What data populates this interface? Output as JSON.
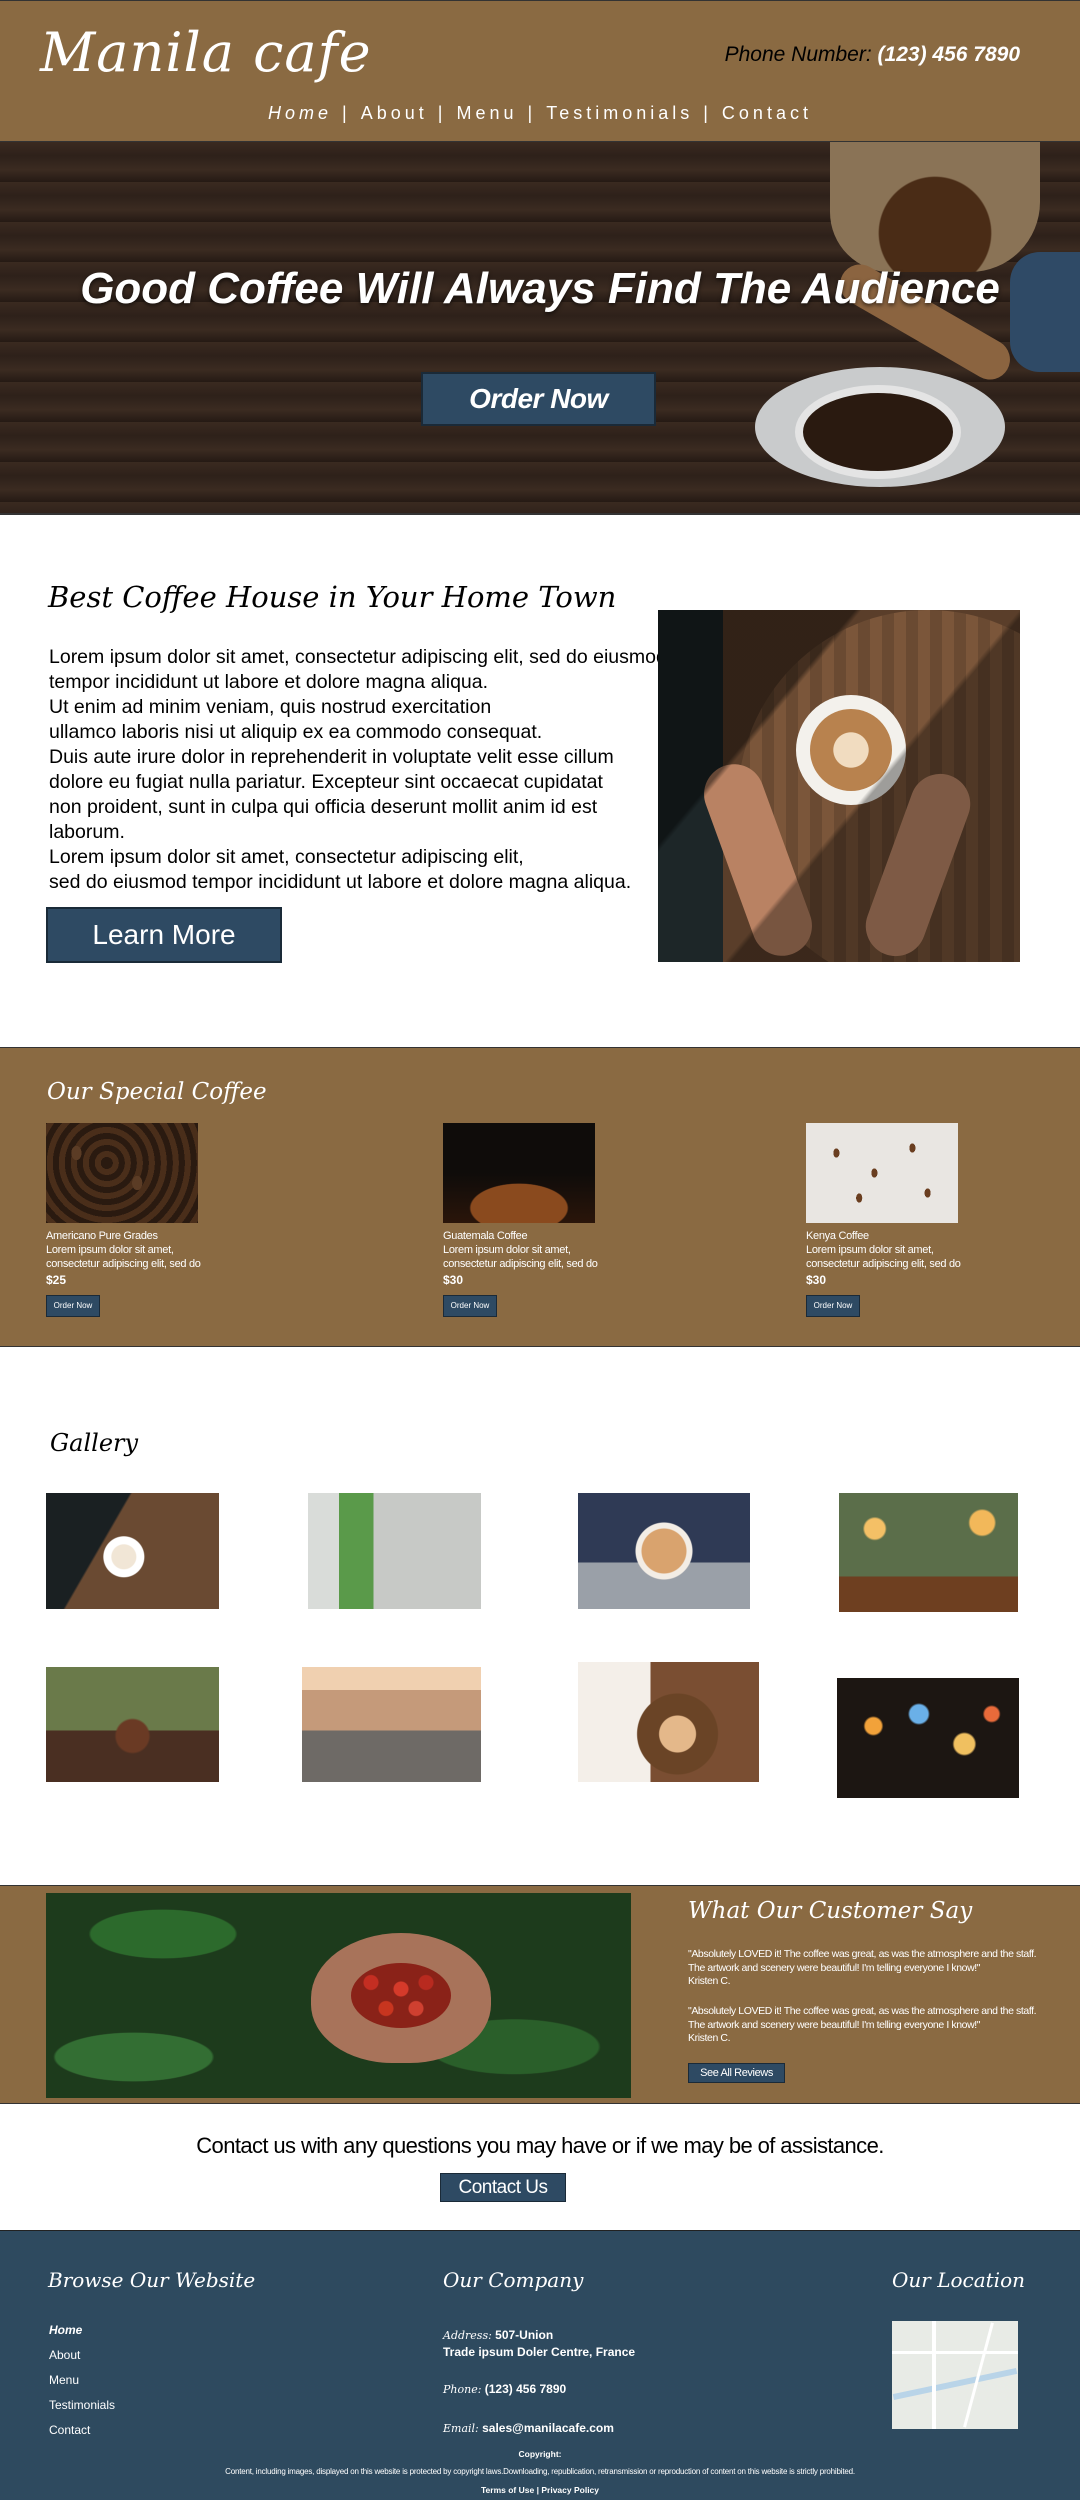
{
  "header": {
    "logo": "Manila  cafe",
    "phone_label": "Phone Number:",
    "phone_value": "(123) 456 7890",
    "nav": [
      "Home",
      "About",
      "Menu",
      "Testimonials",
      "Contact"
    ],
    "nav_separator": "|",
    "active_nav": "Home",
    "background": "#8a6a42"
  },
  "hero": {
    "title": "Good Coffee Will Always Find The Audience",
    "button": "Order Now"
  },
  "about": {
    "title": "Best Coffee House in Your Home Town",
    "paragraph1": "Lorem ipsum dolor sit amet, consectetur adipiscing elit, sed do eiusmod\ntempor incididunt ut labore et dolore magna aliqua.\nUt enim ad minim veniam, quis nostrud exercitation\nullamco laboris nisi ut aliquip ex ea commodo consequat.\nDuis aute irure dolor in reprehenderit in voluptate velit esse cillum\ndolore eu fugiat nulla pariatur. Excepteur sint occaecat cupidatat\nnon proident, sunt in culpa qui officia deserunt mollit anim id est laborum.",
    "paragraph2": "Lorem ipsum dolor sit amet, consectetur adipiscing elit,\nsed do eiusmod tempor incididunt ut labore et dolore magna aliqua.",
    "button": "Learn More"
  },
  "special": {
    "title": "Our Special Coffee",
    "items": [
      {
        "name": "Americano Pure Grades",
        "desc1": "Lorem ipsum dolor sit amet,",
        "desc2": "consectetur adipiscing elit, sed do",
        "price": "$25",
        "button": "Order Now"
      },
      {
        "name": "Guatemala Coffee",
        "desc1": "Lorem ipsum dolor sit amet,",
        "desc2": "consectetur adipiscing elit, sed do",
        "price": "$30",
        "button": "Order Now"
      },
      {
        "name": "Kenya Coffee",
        "desc1": "Lorem ipsum dolor sit amet,",
        "desc2": "consectetur adipiscing elit, sed do",
        "price": "$30",
        "button": "Order Now"
      }
    ]
  },
  "gallery": {
    "title": "Gallery"
  },
  "testimonials": {
    "title": "What Our Customer Say",
    "quotes": [
      {
        "text": "\"Absolutely LOVED it! The coffee was great, as was the atmosphere and the staff. The artwork and scenery were beautiful! I'm telling everyone I know!\"",
        "author": "Kristen C."
      },
      {
        "text": "\"Absolutely LOVED it! The coffee was great, as was the atmosphere and the staff. The artwork and scenery were beautiful! I'm telling everyone I know!\"",
        "author": "Kristen C."
      }
    ],
    "button": "See All Reviews"
  },
  "contact": {
    "text": "Contact us with any questions you may have or if we may be of assistance.",
    "button": "Contact Us"
  },
  "footer": {
    "browse_title": "Browse Our Website",
    "links": [
      "Home",
      "About",
      "Menu",
      "Testimonials",
      "Contact"
    ],
    "company_title": "Our Company",
    "address_label": "Address:",
    "address_line1": "507-Union",
    "address_line2": "Trade ipsum Doler Centre, France",
    "phone_label": "Phone:",
    "phone_value": "(123) 456 7890",
    "email_label": "Email:",
    "email_value": "sales@manilacafe.com",
    "location_title": "Our Location",
    "copyright_title": "Copyright:",
    "copyright_text": "Content, including images, displayed on this website is protected by copyright laws.Downloading, republication, retransmission or reproduction of content on this website is strictly prohibited.",
    "terms": "Terms of Use",
    "privacy": "Privacy Policy",
    "link_separator": "|",
    "background": "#2e4a5f"
  },
  "colors": {
    "brand_brown": "#8a6a42",
    "button_blue": "#2e4a63"
  }
}
